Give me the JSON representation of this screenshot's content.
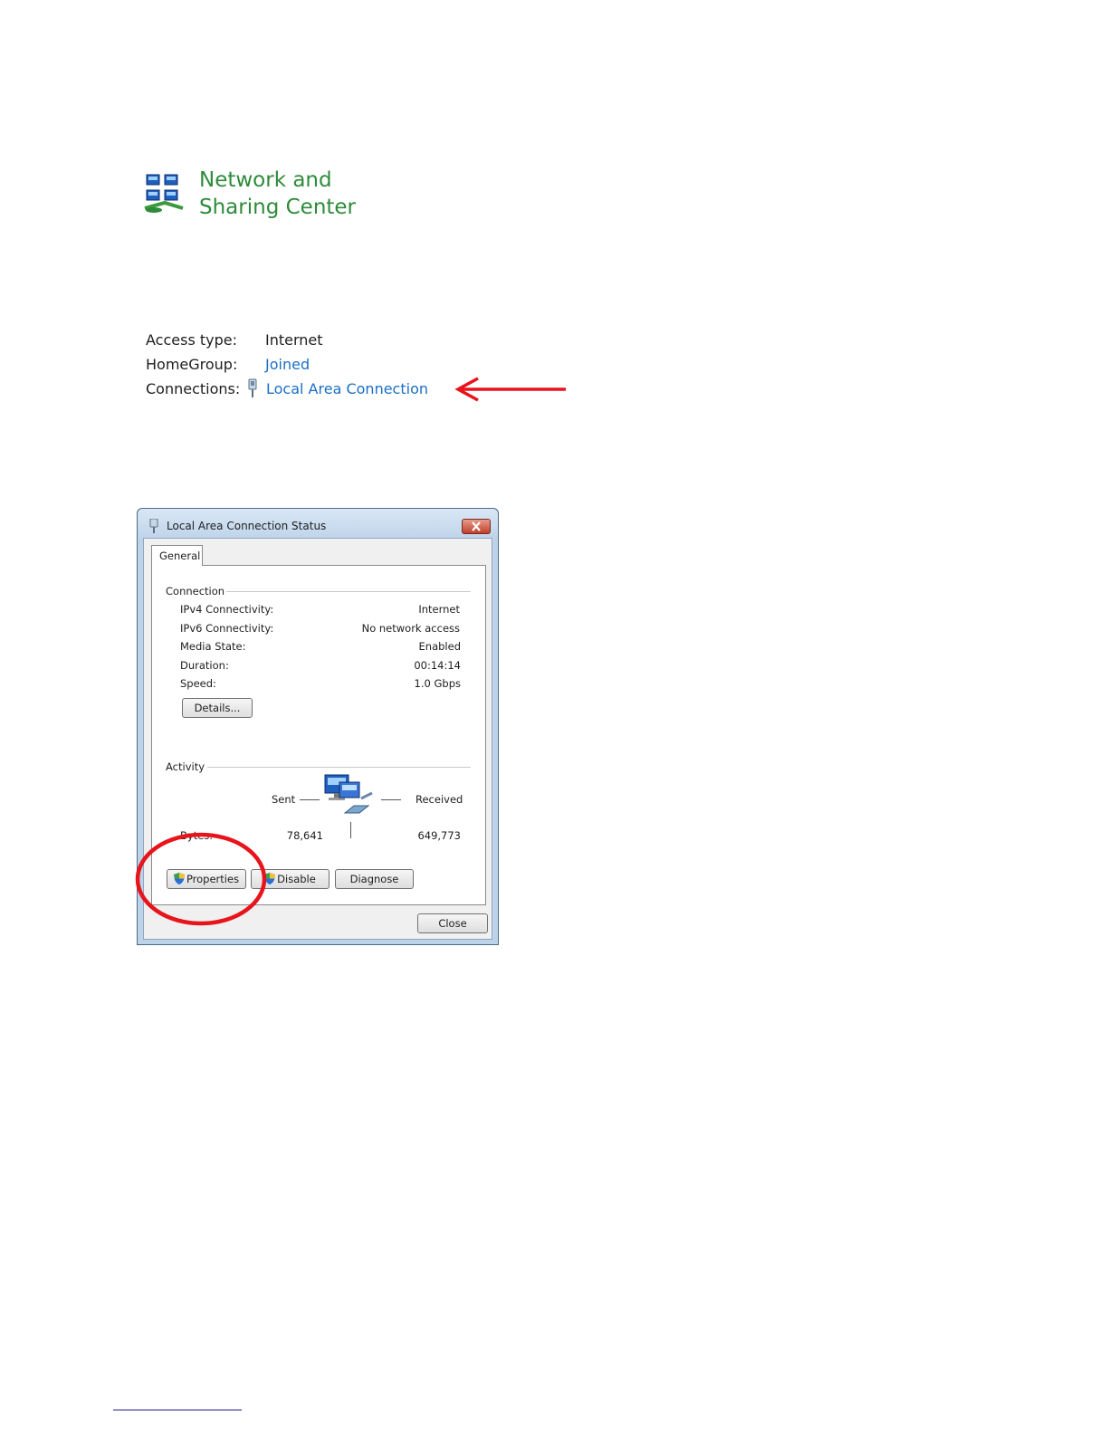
{
  "header": {
    "title": "Network and Sharing Center"
  },
  "info": {
    "access_type_label": "Access type:",
    "access_type_value": "Internet",
    "homegroup_label": "HomeGroup:",
    "homegroup_value": "Joined",
    "connections_label": "Connections:",
    "connections_value": "Local Area Connection"
  },
  "dialog": {
    "title": "Local Area Connection Status",
    "tab_general": "General",
    "connection_group": "Connection",
    "rows": [
      {
        "label": "IPv4 Connectivity:",
        "value": "Internet"
      },
      {
        "label": "IPv6 Connectivity:",
        "value": "No network access"
      },
      {
        "label": "Media State:",
        "value": "Enabled"
      },
      {
        "label": "Duration:",
        "value": "00:14:14"
      },
      {
        "label": "Speed:",
        "value": "1.0 Gbps"
      }
    ],
    "details_button": "Details...",
    "activity_group": "Activity",
    "sent_label": "Sent",
    "received_label": "Received",
    "bytes_label": "Bytes:",
    "bytes_sent": "78,641",
    "bytes_received": "649,773",
    "properties_button": "Properties",
    "disable_button": "Disable",
    "diagnose_button": "Diagnose",
    "close_button": "Close"
  },
  "annotations": {
    "arrow_color": "#e8141c",
    "circle_color": "#e8141c"
  },
  "colors": {
    "title_green": "#2d8b3a",
    "link_blue": "#1a6fc4"
  }
}
